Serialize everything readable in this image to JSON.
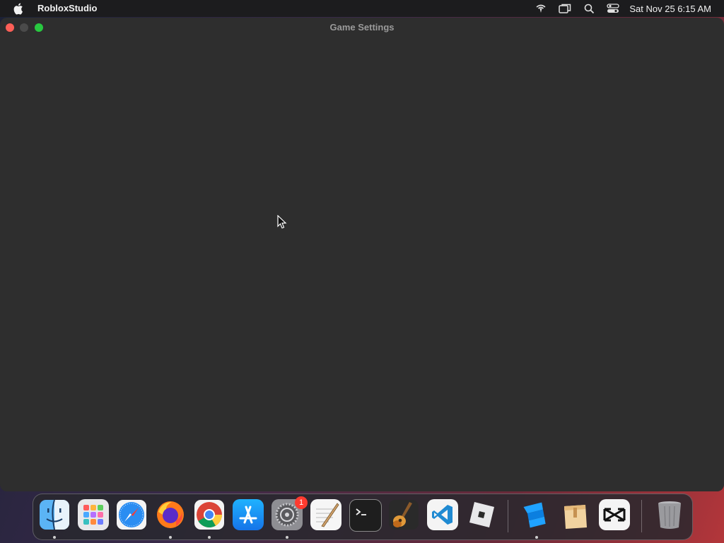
{
  "menubar": {
    "app_name": "RobloxStudio",
    "clock": "Sat Nov 25  6:15 AM",
    "icons": [
      "apple-icon",
      "wifi-icon",
      "screen-mirroring-icon",
      "spotlight-search-icon",
      "control-center-icon"
    ]
  },
  "window": {
    "title": "Game Settings"
  },
  "dock": {
    "apps": [
      {
        "name": "Finder",
        "icon": "finder-icon",
        "running": true
      },
      {
        "name": "Launchpad",
        "icon": "launchpad-icon",
        "running": false
      },
      {
        "name": "Safari",
        "icon": "safari-icon",
        "running": false
      },
      {
        "name": "Firefox",
        "icon": "firefox-icon",
        "running": true
      },
      {
        "name": "Chrome",
        "icon": "chrome-icon",
        "running": true
      },
      {
        "name": "App Store",
        "icon": "app-store-icon",
        "running": false
      },
      {
        "name": "System Settings",
        "icon": "system-settings-icon",
        "running": true,
        "badge": "1"
      },
      {
        "name": "TextEdit",
        "icon": "textedit-icon",
        "running": false
      },
      {
        "name": "Terminal",
        "icon": "terminal-icon",
        "running": false
      },
      {
        "name": "GarageBand",
        "icon": "garageband-icon",
        "running": false
      },
      {
        "name": "VS Code",
        "icon": "vscode-icon",
        "running": false
      },
      {
        "name": "Roblox",
        "icon": "roblox-icon",
        "running": false
      },
      {
        "name": "Roblox Studio",
        "icon": "roblox-studio-icon",
        "running": true
      },
      {
        "name": "Archive Utility",
        "icon": "archive-icon",
        "running": false
      },
      {
        "name": "CapCut",
        "icon": "capcut-icon",
        "running": false
      },
      {
        "name": "Trash",
        "icon": "trash-icon",
        "running": false
      }
    ]
  },
  "colors": {
    "close": "#fe5f57",
    "minimize": "#4a4a4a",
    "maximize": "#28c840",
    "window_bg": "#2e2e2e",
    "menubar_bg": "#1c1c1e"
  }
}
